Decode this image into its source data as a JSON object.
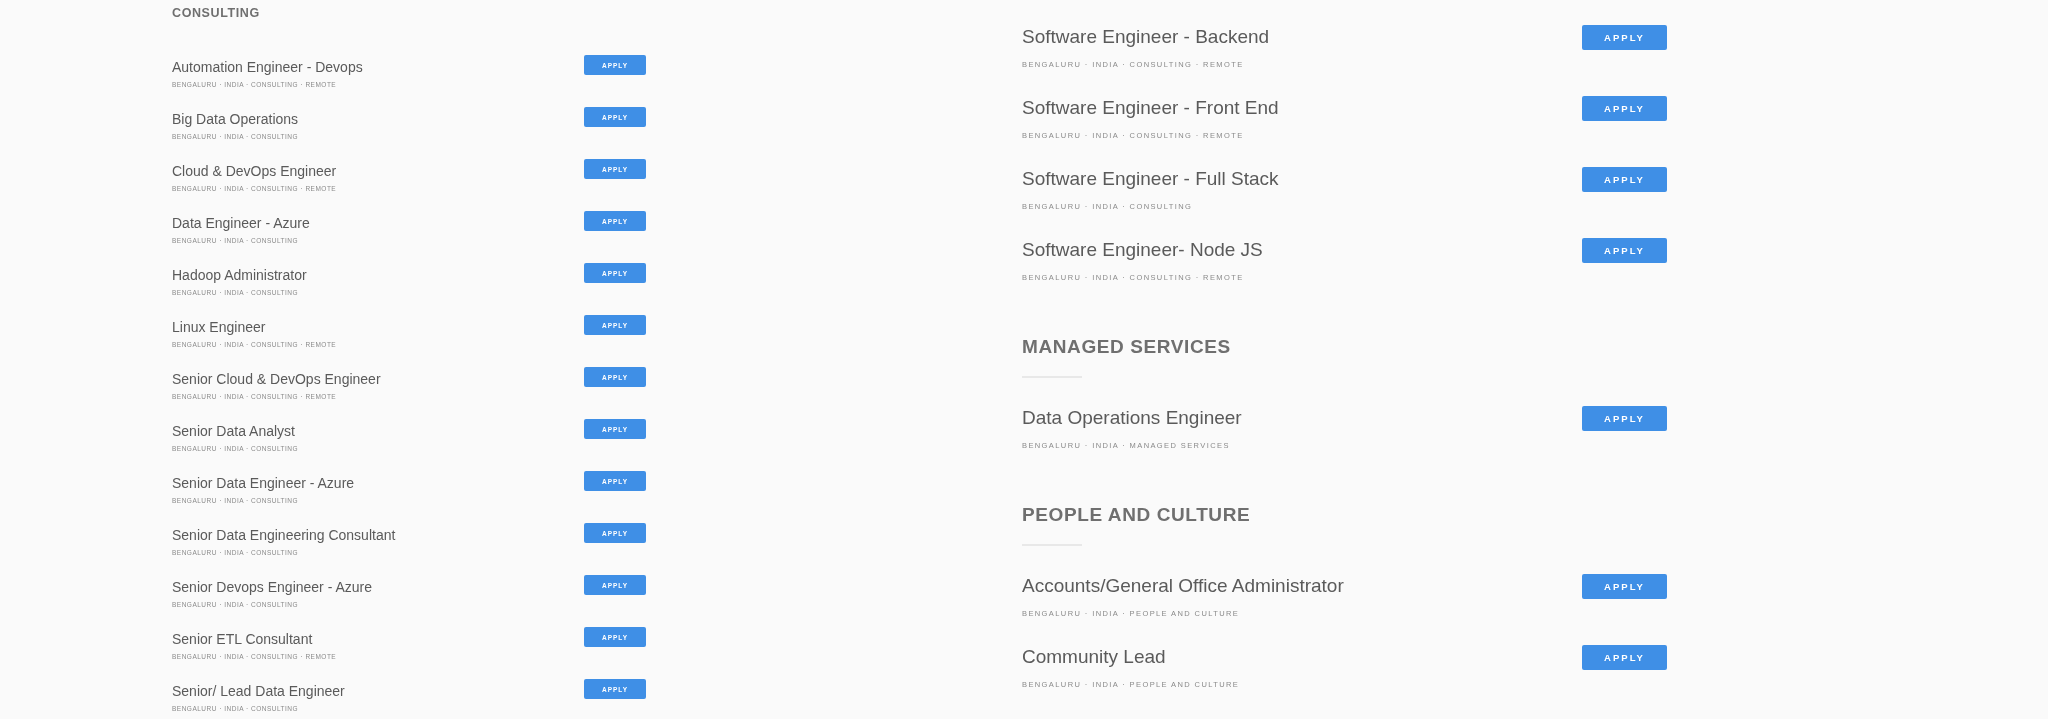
{
  "columns": [
    {
      "kind": "compact",
      "sections": [
        {
          "heading": "CONSULTING",
          "jobs": [
            {
              "title": "Automation Engineer - Devops",
              "meta": "BENGALURU · INDIA · CONSULTING · REMOTE",
              "button": "APPLY"
            },
            {
              "title": "Big Data Operations",
              "meta": "BENGALURU · INDIA · CONSULTING",
              "button": "APPLY"
            },
            {
              "title": "Cloud & DevOps Engineer",
              "meta": "BENGALURU · INDIA · CONSULTING · REMOTE",
              "button": "APPLY"
            },
            {
              "title": "Data Engineer - Azure",
              "meta": "BENGALURU · INDIA · CONSULTING",
              "button": "APPLY"
            },
            {
              "title": "Hadoop Administrator",
              "meta": "BENGALURU · INDIA · CONSULTING",
              "button": "APPLY"
            },
            {
              "title": "Linux Engineer",
              "meta": "BENGALURU · INDIA · CONSULTING · REMOTE",
              "button": "APPLY"
            },
            {
              "title": "Senior Cloud & DevOps Engineer",
              "meta": "BENGALURU · INDIA · CONSULTING · REMOTE",
              "button": "APPLY"
            },
            {
              "title": "Senior Data Analyst",
              "meta": "BENGALURU · INDIA · CONSULTING",
              "button": "APPLY"
            },
            {
              "title": "Senior Data Engineer - Azure",
              "meta": "BENGALURU · INDIA · CONSULTING",
              "button": "APPLY"
            },
            {
              "title": "Senior Data Engineering Consultant",
              "meta": "BENGALURU · INDIA · CONSULTING",
              "button": "APPLY"
            },
            {
              "title": "Senior Devops Engineer - Azure",
              "meta": "BENGALURU · INDIA · CONSULTING",
              "button": "APPLY"
            },
            {
              "title": "Senior ETL Consultant",
              "meta": "BENGALURU · INDIA · CONSULTING · REMOTE",
              "button": "APPLY"
            },
            {
              "title": "Senior/ Lead Data Engineer",
              "meta": "BENGALURU · INDIA · CONSULTING",
              "button": "APPLY"
            }
          ]
        }
      ]
    },
    {
      "kind": "regular",
      "sections": [
        {
          "jobs": [
            {
              "title": "Software Engineer - Backend",
              "meta": "BENGALURU · INDIA · CONSULTING · REMOTE",
              "button": "APPLY"
            },
            {
              "title": "Software Engineer - Front End",
              "meta": "BENGALURU · INDIA · CONSULTING · REMOTE",
              "button": "APPLY"
            },
            {
              "title": "Software Engineer - Full Stack",
              "meta": "BENGALURU · INDIA · CONSULTING",
              "button": "APPLY"
            },
            {
              "title": "Software Engineer- Node JS",
              "meta": "BENGALURU · INDIA · CONSULTING · REMOTE",
              "button": "APPLY"
            }
          ]
        },
        {
          "heading": "MANAGED SERVICES",
          "jobs": [
            {
              "title": "Data Operations Engineer",
              "meta": "BENGALURU · INDIA · MANAGED SERVICES",
              "button": "APPLY"
            }
          ]
        },
        {
          "heading": "PEOPLE AND CULTURE",
          "jobs": [
            {
              "title": "Accounts/General Office Administrator",
              "meta": "BENGALURU · INDIA · PEOPLE AND CULTURE",
              "button": "APPLY"
            },
            {
              "title": "Community Lead",
              "meta": "BENGALURU · INDIA · PEOPLE AND CULTURE",
              "button": "APPLY"
            }
          ]
        }
      ]
    }
  ]
}
